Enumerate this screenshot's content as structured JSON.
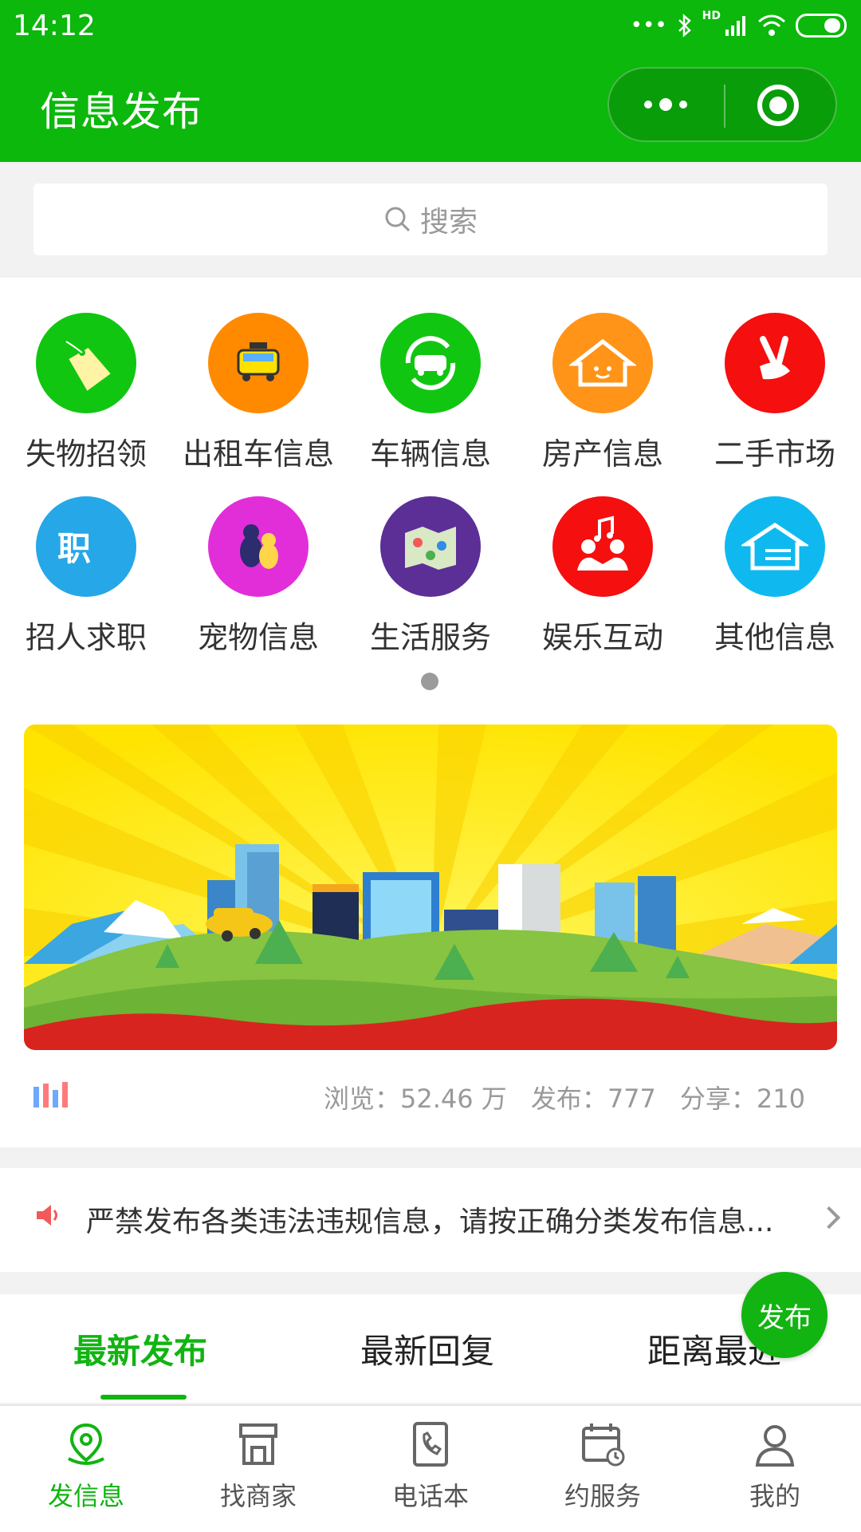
{
  "status_bar": {
    "time": "14:12",
    "network": "HD"
  },
  "header": {
    "title": "信息发布"
  },
  "search": {
    "placeholder": "搜索"
  },
  "categories": [
    {
      "label": "失物招领",
      "color": "#11c611",
      "icon": "price-tag-icon"
    },
    {
      "label": "出租车信息",
      "color": "#ff8a00",
      "icon": "taxi-icon"
    },
    {
      "label": "车辆信息",
      "color": "#11c611",
      "icon": "car-icon"
    },
    {
      "label": "房产信息",
      "color": "#ff9418",
      "icon": "house-icon"
    },
    {
      "label": "二手市场",
      "color": "#f50f0f",
      "icon": "hand-icon"
    },
    {
      "label": "招人求职",
      "color": "#26a7e8",
      "icon": "job-icon"
    },
    {
      "label": "宠物信息",
      "color": "#e22ed9",
      "icon": "pet-icon"
    },
    {
      "label": "生活服务",
      "color": "#5c2f96",
      "icon": "map-icon"
    },
    {
      "label": "娱乐互动",
      "color": "#f50f0f",
      "icon": "music-icon"
    },
    {
      "label": "其他信息",
      "color": "#0fb9f0",
      "icon": "home-icon"
    }
  ],
  "stats": {
    "views": "浏览：52.46 万",
    "posts": "发布：777",
    "shares": "分享：210"
  },
  "notice": {
    "text": "严禁发布各类违法违规信息，请按正确分类发布信息..."
  },
  "tabs": [
    {
      "label": "最新发布",
      "active": true
    },
    {
      "label": "最新回复",
      "active": false
    },
    {
      "label": "距离最近",
      "active": false
    }
  ],
  "fab": {
    "label": "发布"
  },
  "bottom_nav": [
    {
      "label": "发信息",
      "icon": "location-pin-icon",
      "active": true
    },
    {
      "label": "找商家",
      "icon": "store-icon",
      "active": false
    },
    {
      "label": "电话本",
      "icon": "phone-book-icon",
      "active": false
    },
    {
      "label": "约服务",
      "icon": "calendar-icon",
      "active": false
    },
    {
      "label": "我的",
      "icon": "user-icon",
      "active": false
    }
  ],
  "colors": {
    "brand": "#0bb80b",
    "accent": "#11b411"
  }
}
